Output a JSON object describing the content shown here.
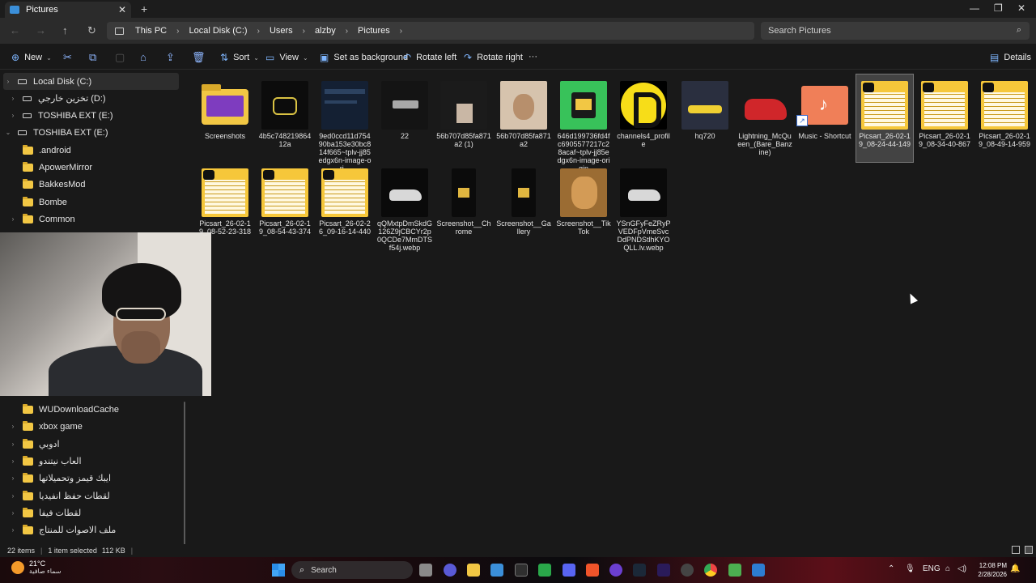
{
  "window": {
    "tab_title": "Pictures",
    "tab_close": "✕",
    "new_tab": "+",
    "minimize": "—",
    "maximize": "❐",
    "close": "✕"
  },
  "nav": {
    "back": "←",
    "forward": "→",
    "up": "↑",
    "refresh": "↻",
    "breadcrumbs": [
      "This PC",
      "Local Disk (C:)",
      "Users",
      "alzby",
      "Pictures"
    ],
    "chevron": "›",
    "search_placeholder": "Search Pictures",
    "search_icon": "⌕"
  },
  "commands": {
    "new": "New",
    "sort": "Sort",
    "view": "View",
    "set_background": "Set as background",
    "rotate_left": "Rotate left",
    "rotate_right": "Rotate right",
    "more": "···",
    "details": "Details",
    "cut": "✂",
    "copy": "⧉",
    "paste": "▢",
    "rename": "⌂",
    "share": "⇪",
    "delete": "🗑"
  },
  "sidebar": {
    "items": [
      {
        "label": "Local Disk (C:)",
        "type": "drive",
        "expander": "›",
        "selected": true
      },
      {
        "label": "تخزين خارجي (D:)",
        "type": "drive",
        "expander": "›"
      },
      {
        "label": "TOSHIBA EXT (E:)",
        "type": "drive",
        "expander": "›"
      },
      {
        "label": "TOSHIBA EXT (E:)",
        "type": "drive",
        "expander": "⌄"
      },
      {
        "label": ".android",
        "type": "folder",
        "expander": ""
      },
      {
        "label": "ApowerMirror",
        "type": "folder",
        "expander": ""
      },
      {
        "label": "BakkesMod",
        "type": "folder",
        "expander": ""
      },
      {
        "label": "Bombe",
        "type": "folder",
        "expander": ""
      },
      {
        "label": "Common",
        "type": "folder",
        "expander": "›"
      }
    ],
    "lower_items": [
      {
        "label": "WUDownloadCache",
        "expander": ""
      },
      {
        "label": "xbox game",
        "expander": "›"
      },
      {
        "label": "ادوبي",
        "expander": "›"
      },
      {
        "label": "العاب نيتندو",
        "expander": "›"
      },
      {
        "label": "ايبك قيمز وتحميلاتها",
        "expander": "›"
      },
      {
        "label": "لقطات حفظ انفيديا",
        "expander": "›"
      },
      {
        "label": "لقطات فيفا",
        "expander": "›"
      },
      {
        "label": "ملف الاصوات للمنتاج",
        "expander": "›"
      }
    ]
  },
  "files": {
    "row1": [
      {
        "name": "Screenshots",
        "kind": "folder"
      },
      {
        "name": "4b5c74821986412a",
        "kind": "dark"
      },
      {
        "name": "9ed0ccd11d75490ba153e30bc814f665~tplv-jj85edgx6n-image-ori...",
        "kind": "screen"
      },
      {
        "name": "22",
        "kind": "logo22"
      },
      {
        "name": "56b707d85fa871a2 (1)",
        "kind": "small"
      },
      {
        "name": "56b707d85fa871a2",
        "kind": "photo"
      },
      {
        "name": "646d199736fd4fc6905577217c28acaf~tplv-jj85edgx6n-image-origin",
        "kind": "green"
      },
      {
        "name": "channels4_profile",
        "kind": "channel"
      },
      {
        "name": "hq720",
        "kind": "game"
      },
      {
        "name": "Lightning_McQueen_(Bare_Banzine)",
        "kind": "mcqueen"
      },
      {
        "name": "Music - Shortcut",
        "kind": "music"
      },
      {
        "name": "Picsart_26-02-19_08-24-44-149",
        "kind": "ticket",
        "selected": true
      },
      {
        "name": "Picsart_26-02-19_08-34-40-867",
        "kind": "ticket"
      },
      {
        "name": "Picsart_26-02-19_08-49-14-959",
        "kind": "ticket"
      }
    ],
    "row2": [
      {
        "name": "Picsart_26-02-19_08-52-23-318",
        "kind": "ticket"
      },
      {
        "name": "Picsart_26-02-19_08-54-43-374",
        "kind": "ticket"
      },
      {
        "name": "Picsart_26-02-26_09-16-14-440",
        "kind": "ticket"
      },
      {
        "name": "qQMxtpDmSkdG126Z9jCBCYr2p0QCDe7MmDTSf54j.webp",
        "kind": "carwhite"
      },
      {
        "name": "Screenshot__Chrome",
        "kind": "phone"
      },
      {
        "name": "Screenshot__Gallery",
        "kind": "phone"
      },
      {
        "name": "Screenshot__TikTok",
        "kind": "lion"
      },
      {
        "name": "YSnGFyFeZRyPVEDFpVmeSvcDdPNDStlhKYOQLL.lv.webp",
        "kind": "carwhite"
      }
    ]
  },
  "status": {
    "items": "22 items",
    "selected": "1 item selected",
    "size": "112 KB",
    "sep": "|"
  },
  "taskbar": {
    "temp": "21°C",
    "condition": "سماء صافية",
    "search_label": "Search",
    "search_glyph": "⌕",
    "lang": "ENG",
    "time": "12:08 PM",
    "date": "2/28/2026",
    "tray_up": "⌃",
    "mic": "🎙",
    "net": "⌂",
    "vol": "◁)",
    "bell": "🔔"
  },
  "colors": {
    "accent": "#7fb6ff",
    "folder": "#f2c744",
    "selected_tile": "#434343"
  }
}
